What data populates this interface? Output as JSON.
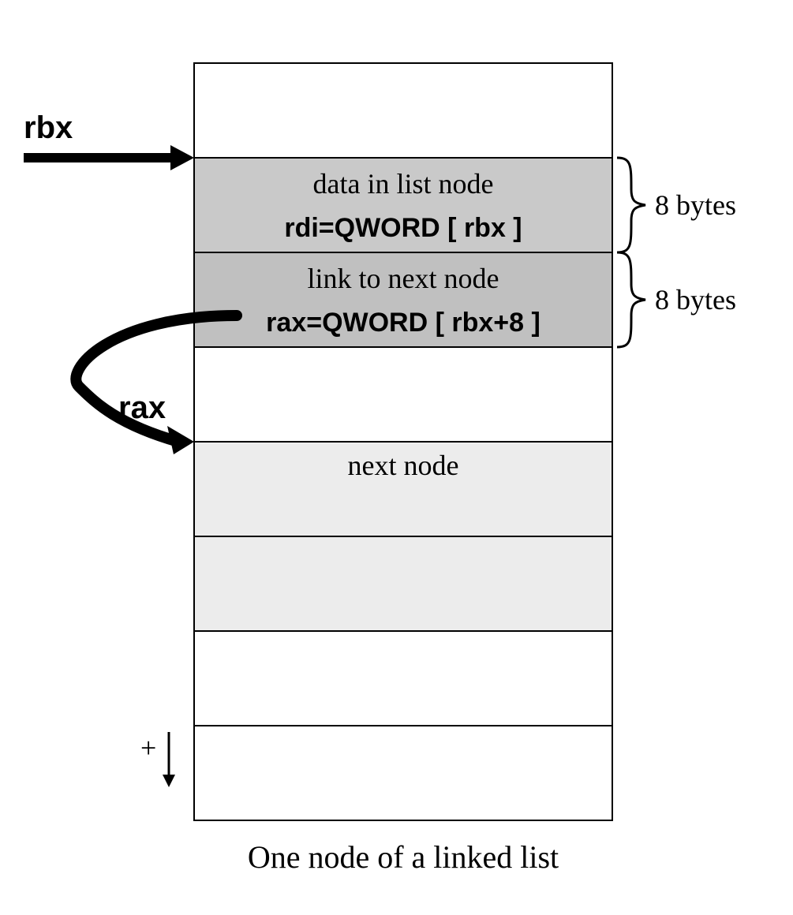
{
  "labels": {
    "rbx": "rbx",
    "rax": "rax",
    "plus": "+",
    "caption": "One node of a linked list"
  },
  "rows": {
    "data": {
      "title": "data in list node",
      "expr": "rdi=QWORD [ rbx ]"
    },
    "link": {
      "title": "link to next node",
      "expr": "rax=QWORD [ rbx+8 ]"
    },
    "next": {
      "title": "next node"
    }
  },
  "sizes": {
    "data_bytes": "8 bytes",
    "link_bytes": "8 bytes"
  }
}
